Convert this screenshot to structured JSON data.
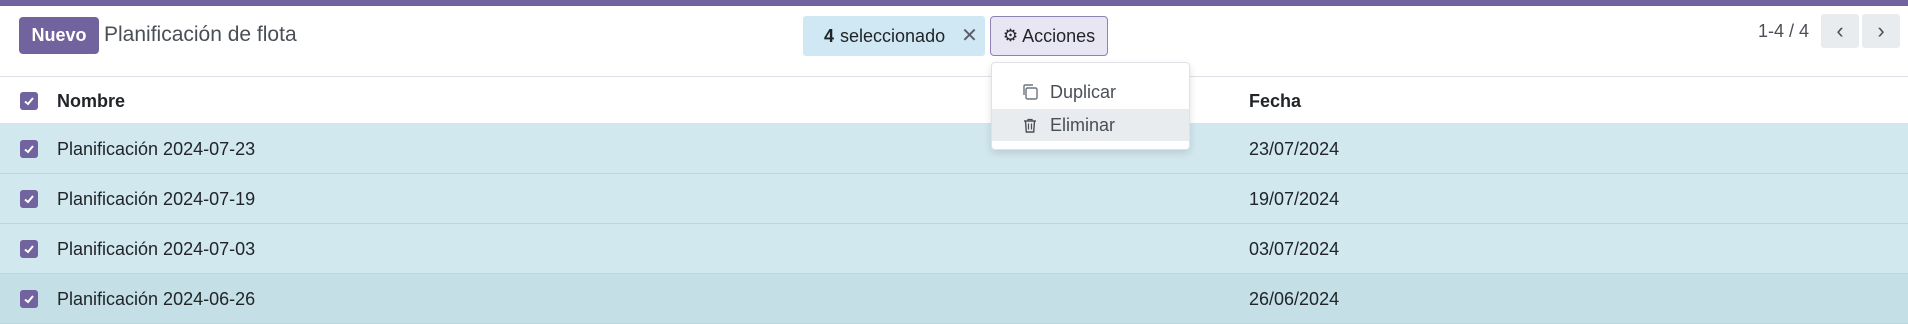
{
  "control_panel": {
    "new_button": "Nuevo",
    "breadcrumb": "Planificación de flota",
    "selection": {
      "count": "4",
      "label": "seleccionado",
      "clear_icon": "close-icon"
    },
    "actions_button": "Acciones",
    "actions_icon": "gear-icon"
  },
  "pager": {
    "value": "1-4 / 4"
  },
  "actions_menu": {
    "items": [
      {
        "label": "Duplicar",
        "icon": "copy-icon"
      },
      {
        "label": "Eliminar",
        "icon": "trash-icon"
      }
    ]
  },
  "list": {
    "columns": [
      "Nombre",
      "Fecha"
    ],
    "rows": [
      {
        "name": "Planificación 2024-07-23",
        "date": "23/07/2024",
        "selected": true
      },
      {
        "name": "Planificación 2024-07-19",
        "date": "19/07/2024",
        "selected": true
      },
      {
        "name": "Planificación 2024-07-03",
        "date": "03/07/2024",
        "selected": true
      },
      {
        "name": "Planificación 2024-06-26",
        "date": "26/06/2024",
        "selected": true
      }
    ]
  },
  "colors": {
    "brand": "#71639e",
    "selected_row": "#d1e8ee",
    "selection_badge": "#cfe8f3"
  }
}
